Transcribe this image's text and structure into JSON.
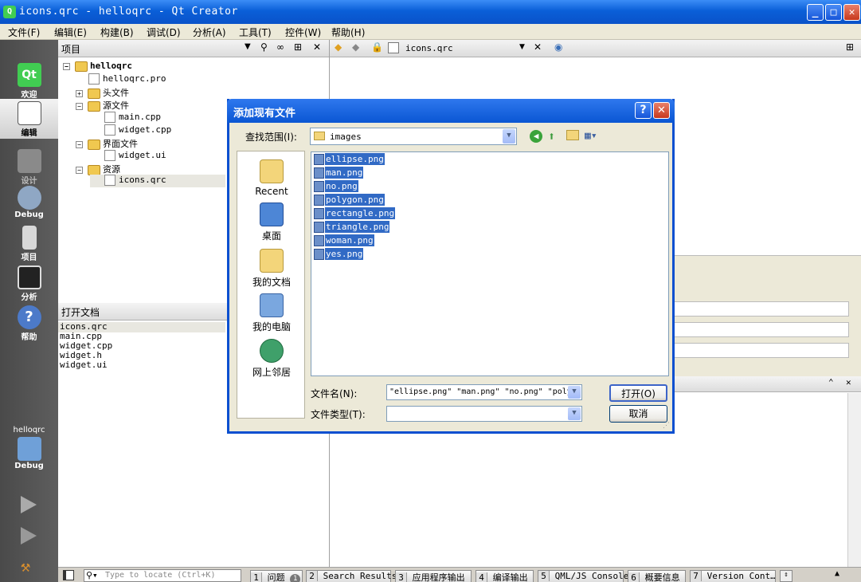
{
  "window": {
    "title": "icons.qrc - helloqrc - Qt Creator",
    "app_icon": "qt-icon"
  },
  "menu": [
    "文件(F)",
    "编辑(E)",
    "构建(B)",
    "调试(D)",
    "分析(A)",
    "工具(T)",
    "控件(W)",
    "帮助(H)"
  ],
  "modes": [
    {
      "label": "欢迎",
      "icon": "qt-logo-icon"
    },
    {
      "label": "编辑",
      "icon": "edit-document-icon"
    },
    {
      "label": "设计",
      "icon": "design-icon"
    },
    {
      "label": "Debug",
      "icon": "debug-icon"
    },
    {
      "label": "项目",
      "icon": "projects-icon"
    },
    {
      "label": "分析",
      "icon": "analyze-icon"
    },
    {
      "label": "帮助",
      "icon": "help-icon"
    }
  ],
  "kit": {
    "project": "helloqrc",
    "config": "Debug"
  },
  "project_panel": {
    "title": "项目",
    "tree": [
      {
        "label": "helloqrc",
        "level": 0
      },
      {
        "label": "helloqrc.pro",
        "level": 1
      },
      {
        "label": "头文件",
        "level": 1
      },
      {
        "label": "源文件",
        "level": 1
      },
      {
        "label": "main.cpp",
        "level": 2
      },
      {
        "label": "widget.cpp",
        "level": 2
      },
      {
        "label": "界面文件",
        "level": 1
      },
      {
        "label": "widget.ui",
        "level": 2
      },
      {
        "label": "资源",
        "level": 1
      },
      {
        "label": "icons.qrc",
        "level": 2
      }
    ]
  },
  "open_docs": {
    "title": "打开文档",
    "items": [
      "icons.qrc",
      "main.cpp",
      "widget.cpp",
      "widget.h",
      "widget.ui"
    ]
  },
  "editor": {
    "file": "icons.qrc"
  },
  "dialog": {
    "title": "添加现有文件",
    "look_in_label": "查找范围(I):",
    "look_in_value": "images",
    "places": [
      "Recent",
      "桌面",
      "我的文档",
      "我的电脑",
      "网上邻居"
    ],
    "files": [
      "ellipse.png",
      "man.png",
      "no.png",
      "polygon.png",
      "rectangle.png",
      "triangle.png",
      "woman.png",
      "yes.png"
    ],
    "filename_label": "文件名(N):",
    "filename_value": "\"ellipse.png\" \"man.png\" \"no.png\" \"poly",
    "filetype_label": "文件类型(T):",
    "filetype_value": "",
    "open_button": "打开(O)",
    "cancel_button": "取消"
  },
  "locator": {
    "placeholder": "Type to locate (Ctrl+K)"
  },
  "output_tabs": [
    {
      "num": "1",
      "label": "问题",
      "badge": "1"
    },
    {
      "num": "2",
      "label": "Search Results"
    },
    {
      "num": "3",
      "label": "应用程序输出"
    },
    {
      "num": "4",
      "label": "编译输出"
    },
    {
      "num": "5",
      "label": "QML/JS Console"
    },
    {
      "num": "6",
      "label": "概要信息"
    },
    {
      "num": "7",
      "label": "Version Cont…"
    }
  ]
}
